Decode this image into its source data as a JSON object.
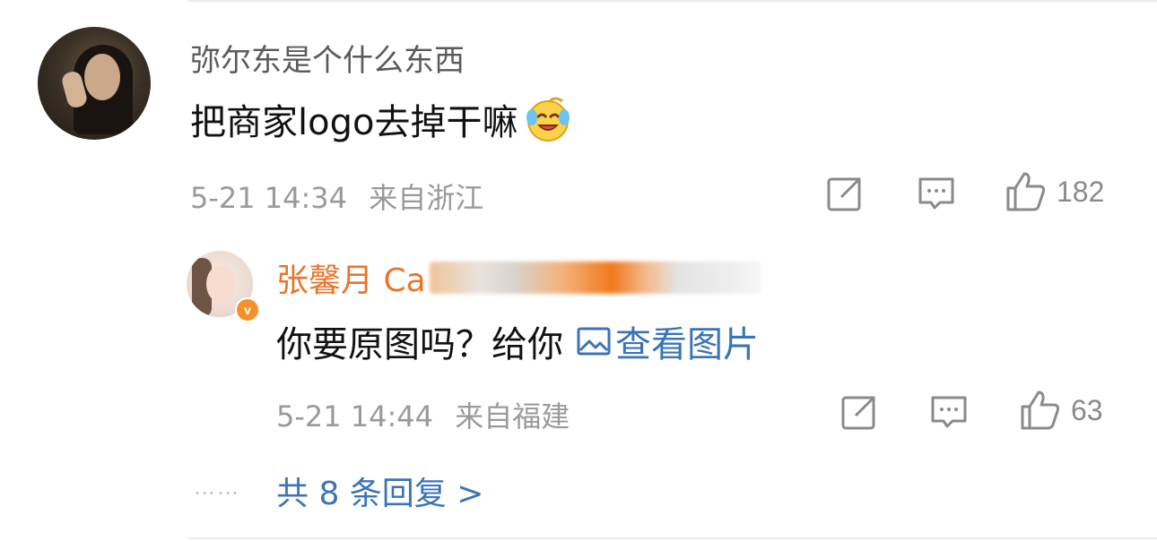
{
  "comment": {
    "username": "弥尔东是个什么东西",
    "text": "把商家logo去掉干嘛",
    "emoji_icon": "laughing-crying-emoji",
    "date": "5-21 14:34",
    "location": "来自浙江",
    "like_count": "182"
  },
  "reply": {
    "username": "张馨月 Ca",
    "text": "你要原图吗？给你",
    "view_image_label": "查看图片",
    "date": "5-21 14:44",
    "location": "来自福建",
    "like_count": "63",
    "verified_badge": "v"
  },
  "more": {
    "dots": "……",
    "label": "共 8 条回复 >"
  },
  "colors": {
    "username_gray": "#5a5a5a",
    "reply_name_orange": "#e8752a",
    "link_blue": "#3b74b5",
    "meta_gray": "#9a9a9a",
    "badge_orange": "#f5912a"
  }
}
